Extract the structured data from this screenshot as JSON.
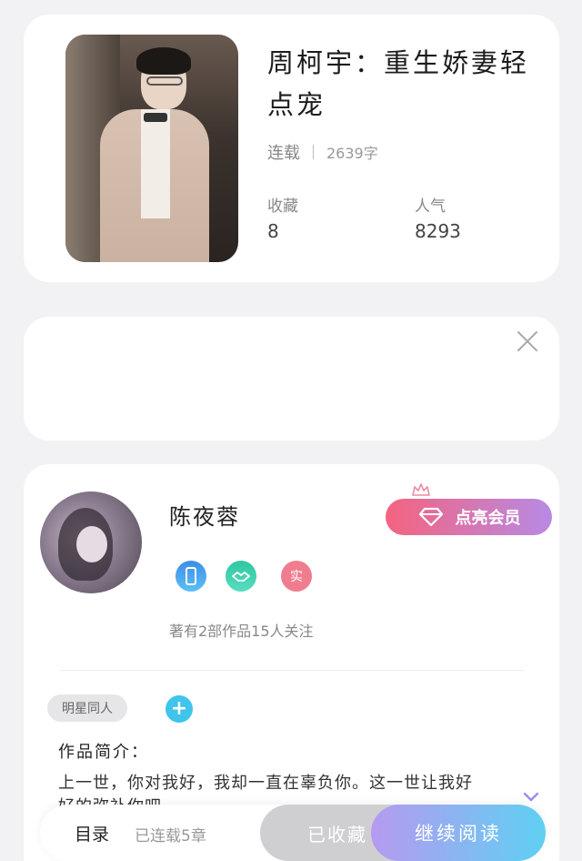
{
  "book": {
    "title": "周柯宇：重生娇妻轻点宠",
    "status": "连载",
    "word_count": "2639字",
    "favorites_label": "收藏",
    "favorites_value": "8",
    "popularity_label": "人气",
    "popularity_value": "8293"
  },
  "ad": {
    "close_icon": "close-icon"
  },
  "author": {
    "name": "陈夜蓉",
    "vip_label": "点亮会员",
    "badge_real": "实",
    "works_line": "著有2部作品15人关注"
  },
  "tags": {
    "tag_label": "明星同人",
    "add_icon": "+"
  },
  "intro": {
    "label": "作品简介：",
    "text": "上一世，你对我好，我却一直在辜负你。这一世让我好好的弥补你吧"
  },
  "bottom_bar": {
    "toc_label": "目录",
    "serial_label": "已连载5章",
    "favorite_button": "已收藏",
    "continue_button": "继续阅读"
  },
  "colors": {
    "vip_gradient_start": "#f4637f",
    "vip_gradient_end": "#b78ae4",
    "read_gradient_start": "#b69af0",
    "read_gradient_end": "#5ed0f2",
    "plus_button": "#3fc4ec"
  }
}
